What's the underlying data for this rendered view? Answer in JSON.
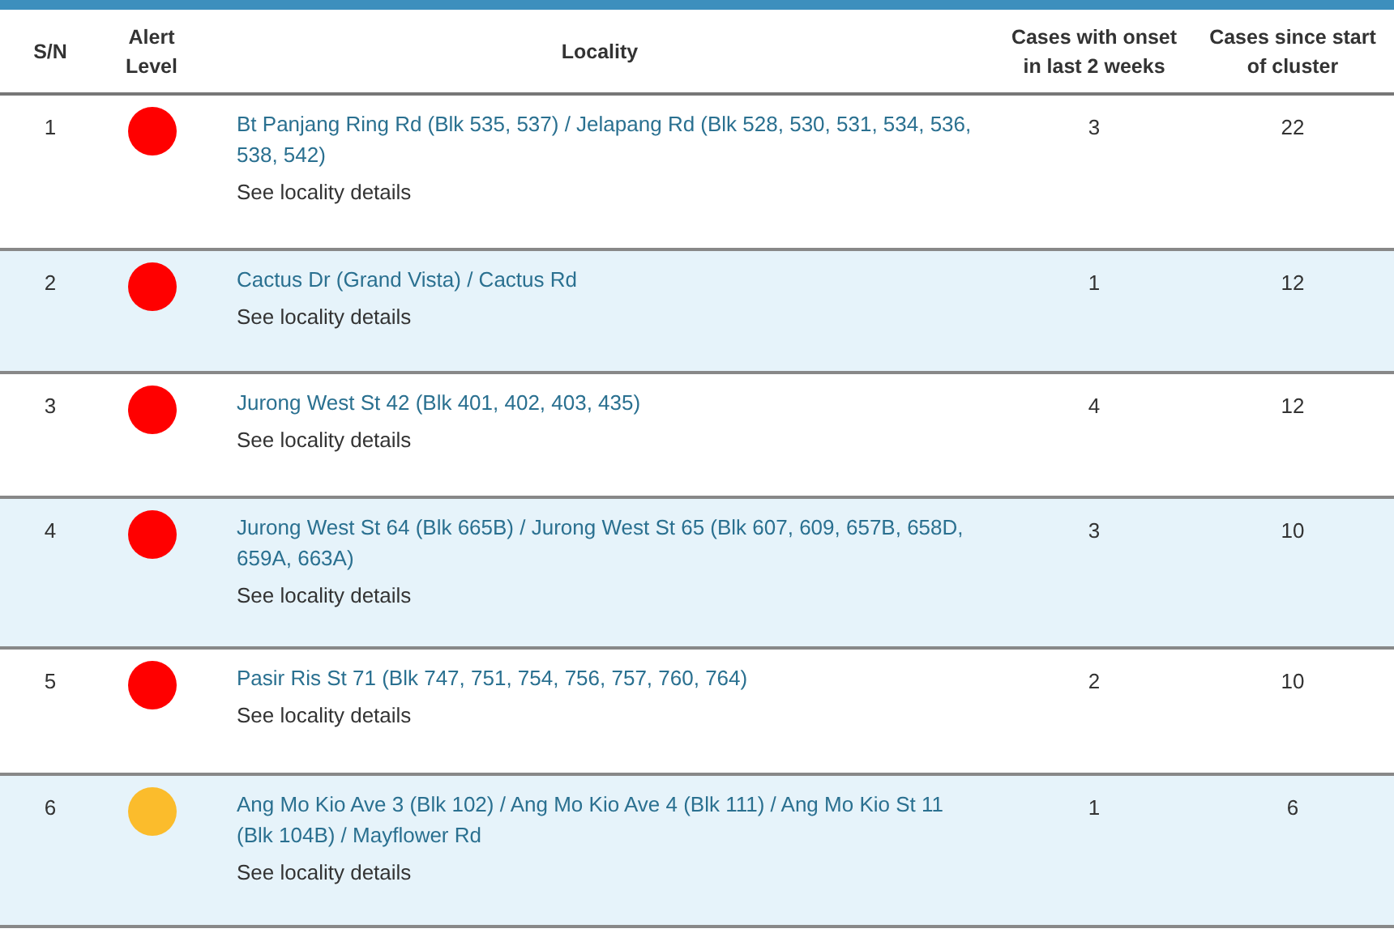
{
  "table": {
    "columns": [
      "S/N",
      "Alert Level",
      "Locality",
      "Cases with onset in last 2 weeks",
      "Cases since start of cluster"
    ],
    "rows": [
      {
        "sn": "1",
        "color": "#ff0000",
        "locality": "Bt Panjang Ring Rd (Blk 535, 537) / Jelapang Rd (Blk 528, 530, 531, 534, 536, 538, 542)",
        "details": "See locality details",
        "recent": "3",
        "total": "22"
      },
      {
        "sn": "2",
        "color": "#ff0000",
        "locality": "Cactus Dr (Grand Vista) / Cactus Rd",
        "details": "See locality details",
        "recent": "1",
        "total": "12"
      },
      {
        "sn": "3",
        "color": "#ff0000",
        "locality": "Jurong West St 42 (Blk 401, 402, 403, 435)",
        "details": "See locality details",
        "recent": "4",
        "total": "12"
      },
      {
        "sn": "4",
        "color": "#ff0000",
        "locality": "Jurong West St 64 (Blk 665B) / Jurong West St 65 (Blk 607, 609, 657B, 658D, 659A, 663A)",
        "details": "See locality details",
        "recent": "3",
        "total": "10"
      },
      {
        "sn": "5",
        "color": "#ff0000",
        "locality": "Pasir Ris St 71 (Blk 747, 751, 754, 756, 757, 760, 764)",
        "details": "See locality details",
        "recent": "2",
        "total": "10"
      },
      {
        "sn": "6",
        "color": "#fbbc2c",
        "locality": "Ang Mo Kio Ave 3 (Blk 102) / Ang Mo Kio Ave 4 (Blk 111) / Ang Mo Kio St 11 (Blk 104B) / Mayflower Rd",
        "details": "See locality details",
        "recent": "1",
        "total": "6"
      }
    ]
  }
}
